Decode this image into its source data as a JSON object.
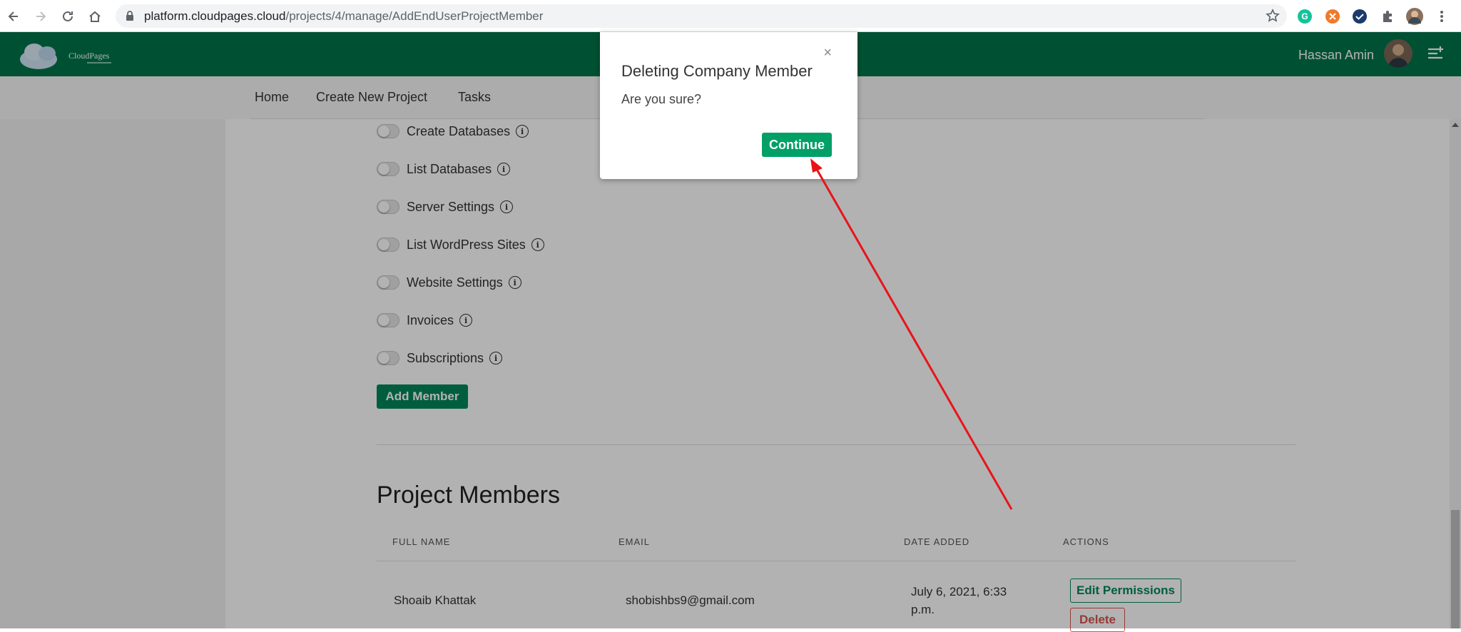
{
  "browser": {
    "url_host": "platform.cloudpages.cloud",
    "url_path": "/projects/4/manage/AddEndUserProjectMember"
  },
  "header": {
    "logo_text": "CloudPages",
    "user_name": "Hassan Amin",
    "brand_color": "#00754a"
  },
  "subnav": {
    "items": [
      "Home",
      "Create New Project",
      "Tasks"
    ]
  },
  "permissions": [
    {
      "label": "Create Databases"
    },
    {
      "label": "List Databases"
    },
    {
      "label": "Server Settings"
    },
    {
      "label": "List WordPress Sites"
    },
    {
      "label": "Website Settings"
    },
    {
      "label": "Invoices"
    },
    {
      "label": "Subscriptions"
    }
  ],
  "add_member_label": "Add Member",
  "members": {
    "title": "Project Members",
    "columns": [
      "FULL NAME",
      "EMAIL",
      "DATE ADDED",
      "ACTIONS"
    ],
    "rows": [
      {
        "full_name": "Shoaib Khattak",
        "email": "shobishbs9@gmail.com",
        "date_line1": "July 6, 2021, 6:33",
        "date_line2": "p.m.",
        "edit_label": "Edit Permissions",
        "delete_label": "Delete"
      }
    ]
  },
  "modal": {
    "title": "Deleting Company Member",
    "close": "×",
    "body": "Are you sure?",
    "continue_label": "Continue"
  },
  "annotation_color": "#e8141a"
}
